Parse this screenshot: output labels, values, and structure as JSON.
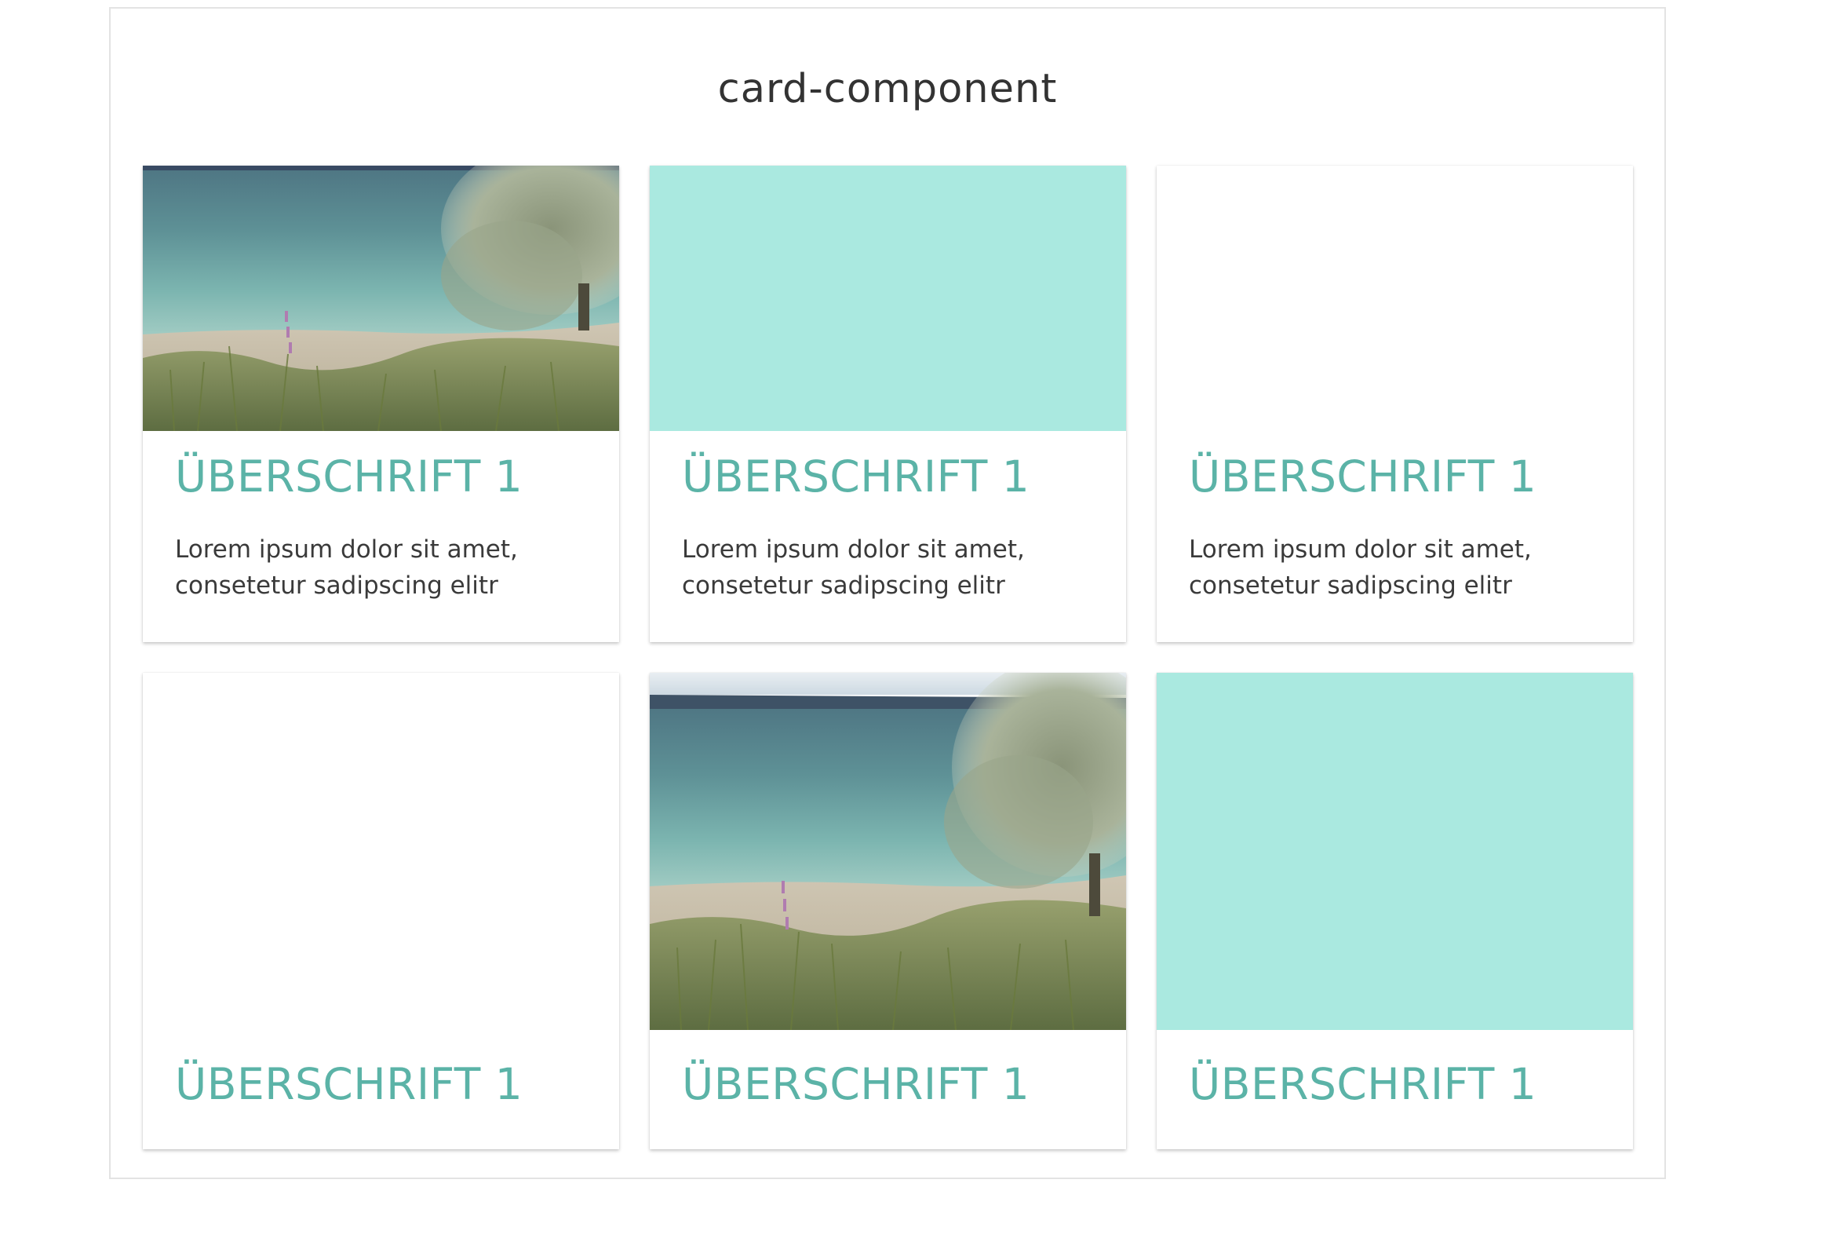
{
  "page": {
    "title": "card-component"
  },
  "cards": [
    {
      "heading": "ÜBERSCHRIFT 1",
      "text": "Lorem ipsum dolor sit amet, consetetur sadipscing elitr",
      "media": "lake-photo"
    },
    {
      "heading": "ÜBERSCHRIFT 1",
      "text": "Lorem ipsum dolor sit amet, consetetur sadipscing elitr",
      "media": "teal-placeholder"
    },
    {
      "heading": "ÜBERSCHRIFT 1",
      "text": "Lorem ipsum dolor sit amet, consetetur sadipscing elitr",
      "media": "empty"
    },
    {
      "heading": "ÜBERSCHRIFT 1",
      "media": "empty"
    },
    {
      "heading": "ÜBERSCHRIFT 1",
      "media": "lake-photo"
    },
    {
      "heading": "ÜBERSCHRIFT 1",
      "media": "teal-placeholder"
    }
  ],
  "colors": {
    "heading": "#5bb3a7",
    "teal_placeholder": "#aae9e0",
    "body_text": "#3a3a3a",
    "title_text": "#333333",
    "frame_border": "#e3e3e3"
  }
}
